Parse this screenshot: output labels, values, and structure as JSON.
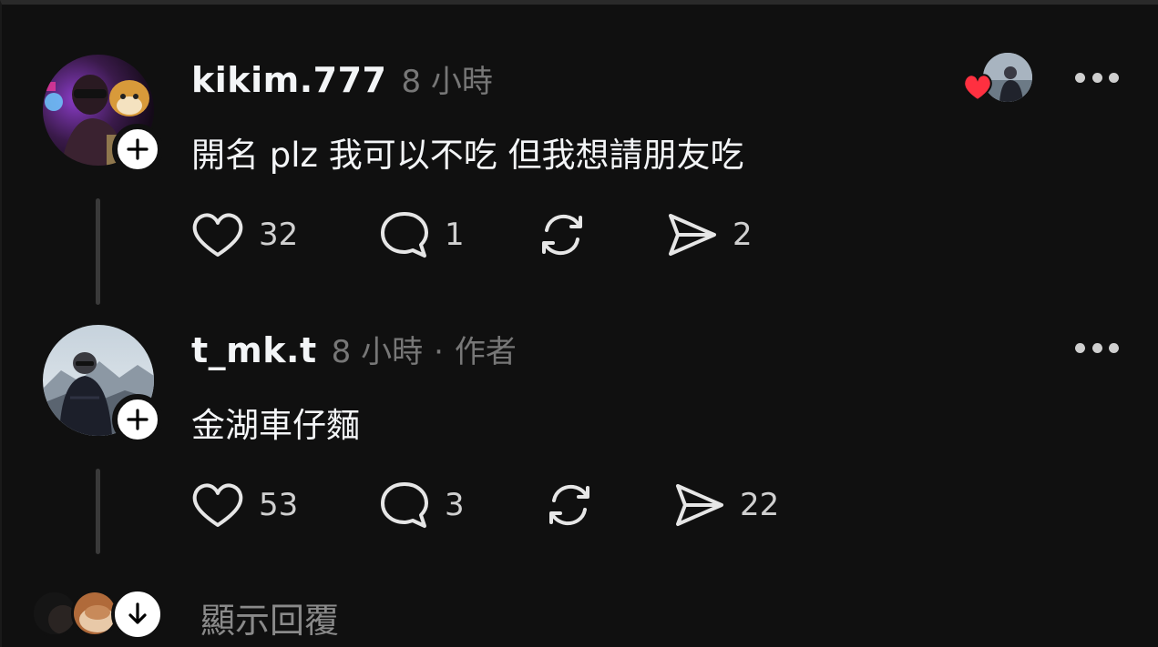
{
  "posts": [
    {
      "username": "kikim.777",
      "time": "8 小時",
      "author_tag": "",
      "text": "開名 plz 我可以不吃 但我想請朋友吃",
      "likes": "32",
      "comments": "1",
      "shares": "2",
      "liked_by_author": true
    },
    {
      "username": "t_mk.t",
      "time": "8 小時",
      "separator": "·",
      "author_tag": "作者",
      "text": "金湖車仔麵",
      "likes": "53",
      "comments": "3",
      "shares": "22"
    }
  ],
  "footer": {
    "show_replies_label": "顯示回覆"
  },
  "icons": {
    "follow": "plus-icon",
    "like": "heart-outline-icon",
    "comment": "speech-bubble-icon",
    "repost": "repost-arrows-icon",
    "share": "paper-plane-icon",
    "more": "ellipsis-icon",
    "liked_badge": "red-heart-icon",
    "expand": "arrow-down-icon"
  },
  "colors": {
    "background": "#101010",
    "text_primary": "#f3f5f7",
    "text_secondary": "#777777",
    "like_red": "#ff3040"
  }
}
